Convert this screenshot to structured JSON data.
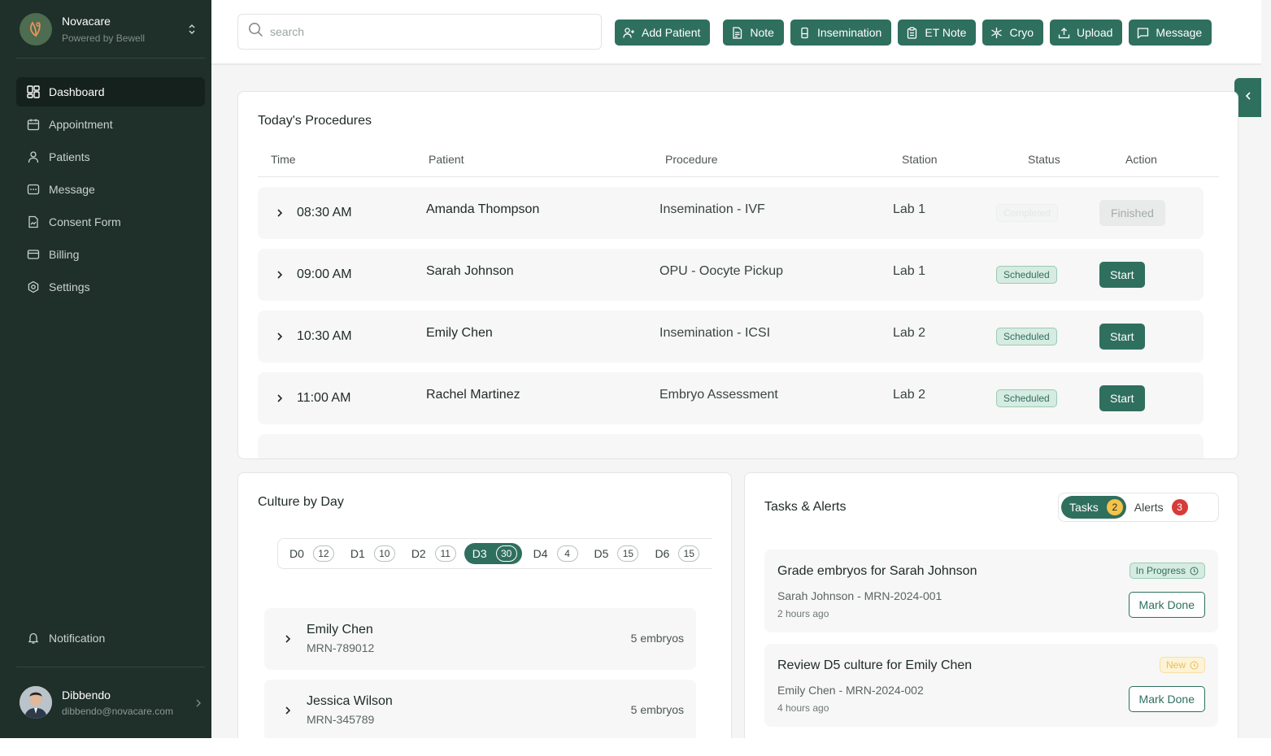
{
  "brand": {
    "name": "Novacare",
    "subtitle": "Powered by Bewell"
  },
  "sidebar": {
    "items": [
      {
        "label": "Dashboard",
        "icon": "dashboard-icon",
        "active": true
      },
      {
        "label": "Appointment",
        "icon": "calendar-icon"
      },
      {
        "label": "Patients",
        "icon": "user-icon"
      },
      {
        "label": "Message",
        "icon": "message-icon"
      },
      {
        "label": "Consent Form",
        "icon": "form-icon"
      },
      {
        "label": "Billing",
        "icon": "billing-icon"
      },
      {
        "label": "Settings",
        "icon": "settings-icon"
      }
    ],
    "notification": "Notification"
  },
  "user": {
    "name": "Dibbendo",
    "email": "dibbendo@novacare.com"
  },
  "search": {
    "placeholder": "search",
    "value": ""
  },
  "toolbar": {
    "buttons": [
      "Add Patient",
      "Note",
      "Insemination",
      "ET Note",
      "Cryo",
      "Upload",
      "Message"
    ]
  },
  "procedures": {
    "title": "Today's Procedures",
    "columns": [
      "Time",
      "Patient",
      "Procedure",
      "Station",
      "Status",
      "Action"
    ],
    "rows": [
      {
        "time": "08:30 AM",
        "patient": "Amanda Thompson",
        "procedure": "Insemination - IVF",
        "station": "Lab 1",
        "status": "Completed",
        "action": "Finished"
      },
      {
        "time": "09:00 AM",
        "patient": "Sarah Johnson",
        "procedure": "OPU - Oocyte Pickup",
        "station": "Lab 1",
        "status": "Scheduled",
        "action": "Start"
      },
      {
        "time": "10:30 AM",
        "patient": "Emily Chen",
        "procedure": "Insemination - ICSI",
        "station": "Lab 2",
        "status": "Scheduled",
        "action": "Start"
      },
      {
        "time": "11:00 AM",
        "patient": "Rachel Martinez",
        "procedure": "Embryo Assessment",
        "station": "Lab 2",
        "status": "Scheduled",
        "action": "Start"
      }
    ]
  },
  "culture": {
    "title": "Culture by Day",
    "days": [
      {
        "label": "D0",
        "count": "12"
      },
      {
        "label": "D1",
        "count": "10"
      },
      {
        "label": "D2",
        "count": "11"
      },
      {
        "label": "D3",
        "count": "30",
        "active": true
      },
      {
        "label": "D4",
        "count": "4"
      },
      {
        "label": "D5",
        "count": "15"
      },
      {
        "label": "D6",
        "count": "15"
      }
    ],
    "patients": [
      {
        "name": "Emily Chen",
        "mrn": "MRN-789012",
        "embryos": "5 embryos"
      },
      {
        "name": "Jessica Wilson",
        "mrn": "MRN-345789",
        "embryos": "5 embryos"
      }
    ]
  },
  "tasks": {
    "title": "Tasks & Alerts",
    "tabs": {
      "tasks_label": "Tasks",
      "tasks_count": "2",
      "alerts_label": "Alerts",
      "alerts_count": "3"
    },
    "items": [
      {
        "title": "Grade embryos for Sarah Johnson",
        "sub": "Sarah Johnson - MRN-2024-001",
        "time": "2 hours ago",
        "badge": "In Progress",
        "button": "Mark Done"
      },
      {
        "title": "Review D5 culture for Emily Chen",
        "sub": "Emily Chen - MRN-2024-002",
        "time": "4 hours ago",
        "badge": "New",
        "button": "Mark Done"
      }
    ]
  },
  "colors": {
    "primary": "#2f6f5e",
    "sidebar": "#1f2f29",
    "warning": "#f3c34a",
    "danger": "#d63b3b"
  }
}
